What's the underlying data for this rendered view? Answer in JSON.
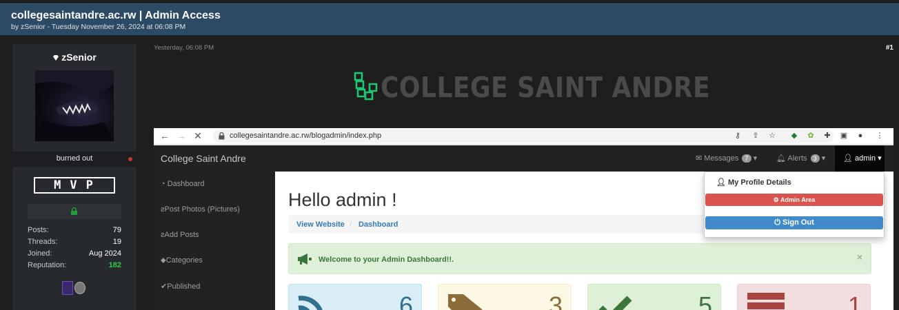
{
  "thread": {
    "title": "collegesaintandre.ac.rw | Admin Access",
    "byline": "by zSenior - Tuesday November 26, 2024 at 06:08 PM"
  },
  "user": {
    "name": "zSenior",
    "title": "burned out",
    "rank": "MVP",
    "stats": [
      {
        "label": "Posts:",
        "value": "79"
      },
      {
        "label": "Threads:",
        "value": "19"
      },
      {
        "label": "Joined:",
        "value": "Aug 2024"
      },
      {
        "label": "Reputation:",
        "value": "182"
      }
    ]
  },
  "post": {
    "date": "Yesterday, 06:08 PM",
    "number": "#1",
    "logo_text": "COLLEGE SAINT ANDRE"
  },
  "browser": {
    "url": "collegesaintandre.ac.rw/blogadmin/index.php"
  },
  "site": {
    "brand": "College Saint Andre",
    "messages_label": "Messages",
    "messages_count": "7",
    "alerts_label": "Alerts",
    "alerts_count": "3",
    "user_label": "admin",
    "side_items": [
      "Dashboard",
      "Post Photos (Pictures)",
      "Add Posts",
      "Categories",
      "Published"
    ],
    "heading": "Hello admin !",
    "breadcrumb": [
      "View Website",
      "/",
      "Dashboard"
    ],
    "alert": "Welcome to your Admin Dashboard!!.",
    "alert_close": "×",
    "cards": [
      {
        "value": "6",
        "bg": "#d9edf7",
        "fg": "#31708f"
      },
      {
        "value": "3",
        "bg": "#fcf8e3",
        "fg": "#8a6d3b"
      },
      {
        "value": "5",
        "bg": "#dff0d8",
        "fg": "#3c763d"
      },
      {
        "value": "1",
        "bg": "#f2dede",
        "fg": "#a94442"
      }
    ],
    "dropdown": {
      "profile": "My Profile Details",
      "admin_area": "Admin Area",
      "sign_out": "Sign Out"
    }
  },
  "colors": {
    "header_bg": "#2c4a63",
    "page_bg": "#1e1e1e",
    "reputation": "#2ecc40",
    "logo_green": "#1ec771"
  }
}
